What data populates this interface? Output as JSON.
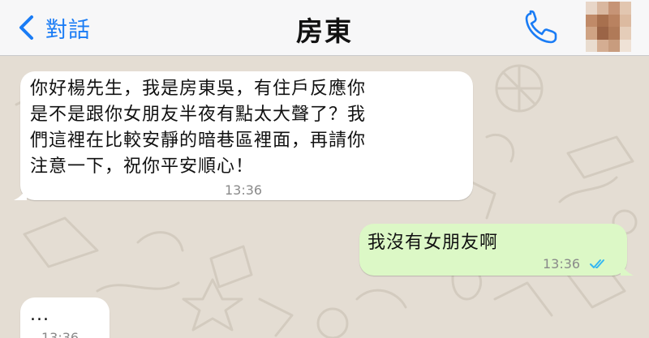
{
  "header": {
    "back_label": "對話",
    "title": "房東",
    "back_icon": "chevron-left-icon",
    "call_icon": "phone-icon"
  },
  "messages": [
    {
      "direction": "incoming",
      "text": "你好楊先生，我是房東吳，有住戶反應你\n是不是跟你女朋友半夜有點太大聲了？我\n們這裡在比較安靜的暗巷區裡面，再請你\n注意一下，祝你平安順心！",
      "time": "13:36"
    },
    {
      "direction": "outgoing",
      "text": "我沒有女朋友啊",
      "time": "13:36",
      "status": "read-receipt-double-check"
    },
    {
      "direction": "incoming",
      "text": "...",
      "time": "13:36"
    }
  ],
  "colors": {
    "accent": "#1a7cf5",
    "chat_background": "#e4ddd3",
    "incoming_bubble": "#ffffff",
    "outgoing_bubble": "#dcf8c6",
    "read_check": "#34b7f1"
  }
}
